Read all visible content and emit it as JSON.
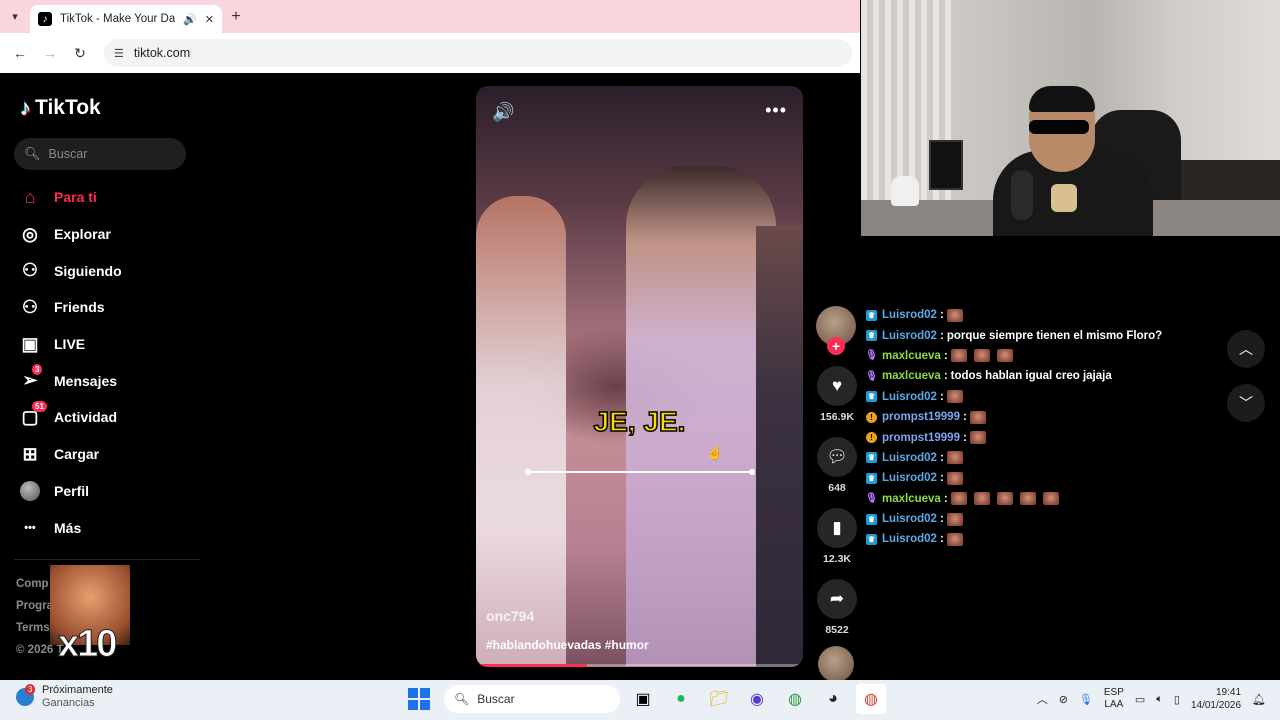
{
  "browser": {
    "tab_title": "TikTok - Make Your Day",
    "url": "tiktok.com"
  },
  "sidebar": {
    "logo_text": "TikTok",
    "search_placeholder": "Buscar",
    "items": [
      {
        "label": "Para ti",
        "icon": "home-icon",
        "active": true
      },
      {
        "label": "Explorar",
        "icon": "compass-icon"
      },
      {
        "label": "Siguiendo",
        "icon": "user-follow-icon"
      },
      {
        "label": "Friends",
        "icon": "friends-icon"
      },
      {
        "label": "LIVE",
        "icon": "live-icon"
      },
      {
        "label": "Mensajes",
        "icon": "send-icon",
        "badge": "3"
      },
      {
        "label": "Actividad",
        "icon": "inbox-icon",
        "badge": "51"
      },
      {
        "label": "Cargar",
        "icon": "upload-icon"
      },
      {
        "label": "Perfil",
        "icon": "avatar"
      },
      {
        "label": "Más",
        "icon": "more-icon"
      }
    ],
    "footer": [
      "Comp",
      "Progra",
      "Terms",
      "© 2026 T"
    ],
    "emote_count": "x10"
  },
  "video": {
    "caption": "JE, JE.",
    "author": "onc794",
    "description": "#hablandohuevadas #humor",
    "progress": 0.34
  },
  "actions": {
    "likes": "156.9K",
    "comments": "648",
    "saves": "12.3K",
    "shares": "8522"
  },
  "chat": [
    {
      "user": "Luisrod02",
      "color": "#5aa8e8",
      "badge": "prime",
      "text": "",
      "emotes": 1
    },
    {
      "user": "Luisrod02",
      "color": "#5aa8e8",
      "badge": "prime",
      "text": "porque siempre tienen el mismo Floro?",
      "emotes": 0
    },
    {
      "user": "maxlcueva",
      "color": "#8ddc3a",
      "badge": "mic",
      "text": "",
      "emotes": 3
    },
    {
      "user": "maxlcueva",
      "color": "#8ddc3a",
      "badge": "mic",
      "text": "todos hablan igual creo jajaja",
      "emotes": 0
    },
    {
      "user": "Luisrod02",
      "color": "#5aa8e8",
      "badge": "prime",
      "text": "",
      "emotes": 1
    },
    {
      "user": "prompst19999",
      "color": "#7aa6f0",
      "badge": "warn",
      "text": "",
      "emotes": 1
    },
    {
      "user": "prompst19999",
      "color": "#7aa6f0",
      "badge": "warn",
      "text": "",
      "emotes": 1
    },
    {
      "user": "Luisrod02",
      "color": "#5aa8e8",
      "badge": "prime",
      "text": "",
      "emotes": 1
    },
    {
      "user": "Luisrod02",
      "color": "#5aa8e8",
      "badge": "prime",
      "text": "",
      "emotes": 1
    },
    {
      "user": "maxlcueva",
      "color": "#8ddc3a",
      "badge": "mic",
      "text": "",
      "emotes": 5
    },
    {
      "user": "Luisrod02",
      "color": "#5aa8e8",
      "badge": "prime",
      "text": "",
      "emotes": 1
    },
    {
      "user": "Luisrod02",
      "color": "#5aa8e8",
      "badge": "prime",
      "text": "",
      "emotes": 1
    }
  ],
  "taskbar": {
    "weather_title": "Próximamente",
    "weather_sub": "Ganancias",
    "weather_badge": "3",
    "search_label": "Buscar",
    "lang_top": "ESP",
    "lang_bottom": "LAA",
    "time": "19:41",
    "date": "14/01/2026"
  },
  "colors": {
    "accent": "#fe2c55",
    "caption": "#f5e000"
  }
}
